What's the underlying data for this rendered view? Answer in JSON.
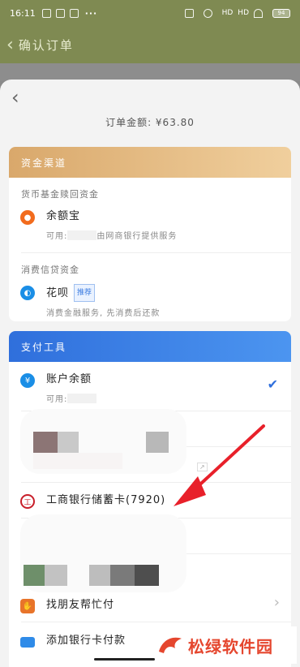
{
  "status_bar": {
    "time": "16:11",
    "dots": "···",
    "signal1": "HD",
    "signal2": "HD",
    "battery": "94"
  },
  "underlay": {
    "title": "确认订单"
  },
  "sheet": {
    "order_amount": "订单金额: ¥63.80",
    "funds": {
      "header": "资金渠道",
      "group1_label": "货币基金赎回资金",
      "yuebao_title": "余额宝",
      "yuebao_sub_prefix": "可用:",
      "yuebao_sub_suffix": "由网商银行提供服务",
      "group2_label": "消费信贷资金",
      "huabei_title": "花呗",
      "huabei_badge": "推荐",
      "huabei_sub": "消费金融服务, 先消费后还款"
    },
    "pay": {
      "header": "支付工具",
      "balance_title": "账户余额",
      "balance_sub_prefix": "可用:",
      "bank_title": "工商银行储蓄卡(7920)",
      "friend_title": "找朋友帮忙付",
      "addcard_title": "添加银行卡付款"
    }
  },
  "icons": {
    "back": "chevron-left-icon",
    "yuebao": "yuebao-icon",
    "huabei": "huabei-icon",
    "balance": "yuan-icon",
    "bank": "icbc-icon",
    "friend": "hand-icon",
    "card": "card-icon"
  },
  "colors": {
    "funds_header": "#d9a86b",
    "pay_header": "#2f6fdc",
    "arrow": "#e8202a"
  },
  "watermark": {
    "text": "松绿软件园"
  }
}
